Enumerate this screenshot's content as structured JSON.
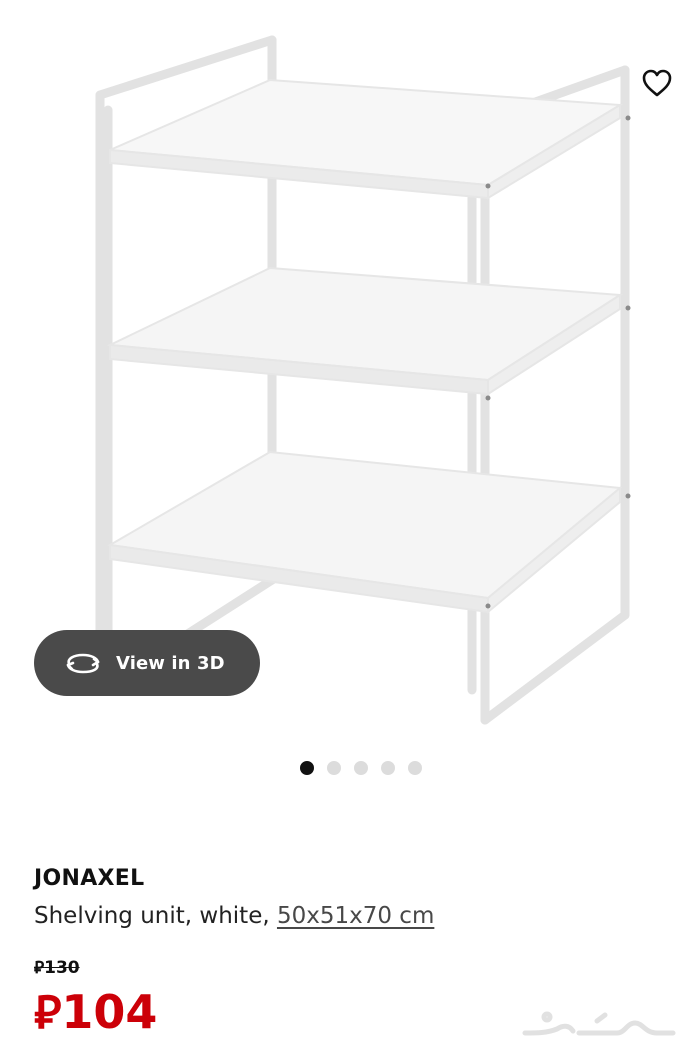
{
  "product": {
    "name": "JONAXEL",
    "description": "Shelving unit, white, ",
    "size": "50x51x70 cm",
    "old_price": "130",
    "new_price": "104",
    "currency_symbol": "⃁",
    "price_color": "#cc0008"
  },
  "gallery": {
    "view3d_label": "View in 3D",
    "total_images": 5,
    "active_index": 0
  },
  "icons": {
    "wishlist": "heart-icon",
    "view3d": "rotate-3d-icon",
    "watermark": "haraj-watermark"
  }
}
